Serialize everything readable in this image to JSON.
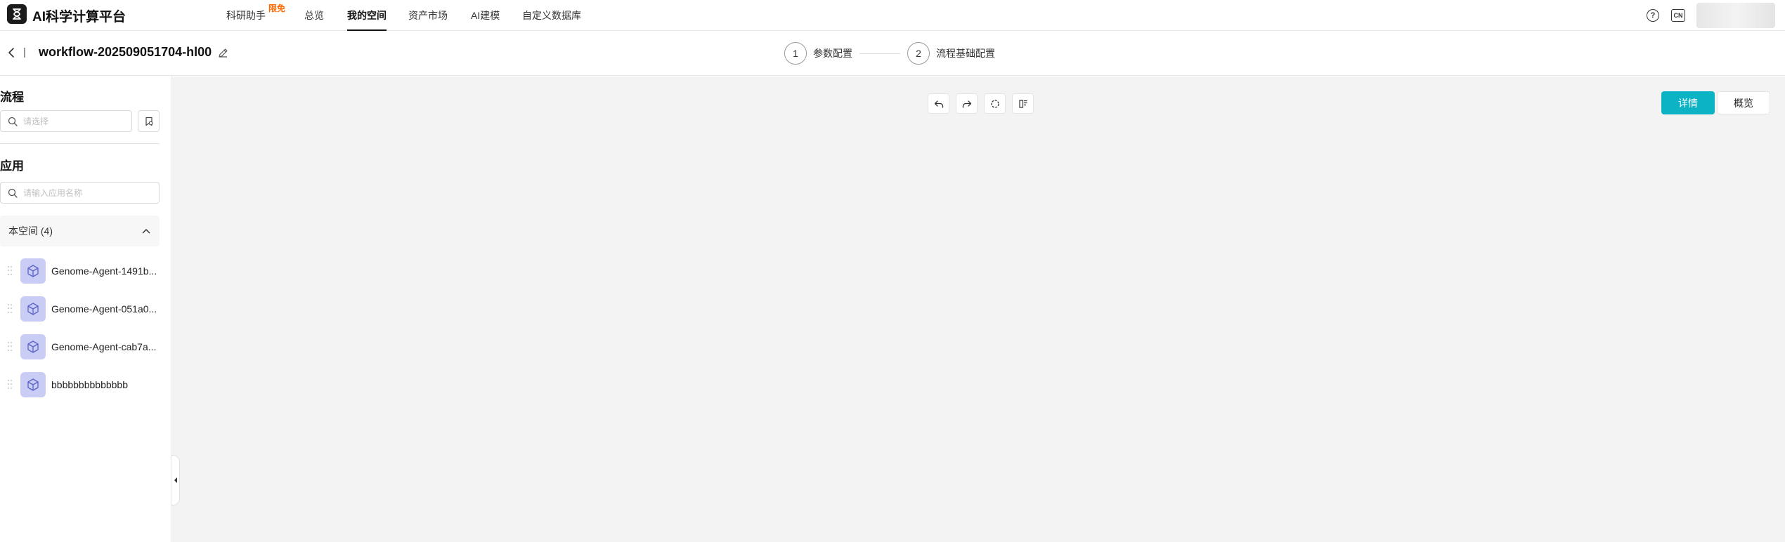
{
  "app": {
    "title": "AI科学计算平台"
  },
  "nav": {
    "items": [
      {
        "label": "科研助手",
        "badge": "限免"
      },
      {
        "label": "总览"
      },
      {
        "label": "我的空间",
        "active": true
      },
      {
        "label": "资产市场"
      },
      {
        "label": "AI建模"
      },
      {
        "label": "自定义数据库"
      }
    ]
  },
  "topbar": {
    "help_icon": "question-circle-icon",
    "lang_label": "CN"
  },
  "workflow": {
    "separator": "|",
    "title": "workflow-202509051704-hl00"
  },
  "steps": [
    {
      "number": "1",
      "label": "参数配置"
    },
    {
      "number": "2",
      "label": "流程基础配置"
    }
  ],
  "sidebar": {
    "flow_title": "流程",
    "flow_search_placeholder": "请选择",
    "app_title": "应用",
    "app_search_placeholder": "请输入应用名称",
    "group_label": "本空间 (4)",
    "apps": [
      {
        "name": "Genome-Agent-1491b..."
      },
      {
        "name": "Genome-Agent-051a0..."
      },
      {
        "name": "Genome-Agent-cab7a..."
      },
      {
        "name": "bbbbbbbbbbbbbb"
      }
    ]
  },
  "canvas": {
    "tools": [
      "undo-icon",
      "redo-icon",
      "reset-icon",
      "layout-icon"
    ],
    "view_buttons": {
      "detail": "详情",
      "overview": "概览"
    }
  },
  "colors": {
    "accent": "#0bb3c5",
    "badge": "#ff6a00",
    "app_icon_bg": "#c9cdf6"
  }
}
